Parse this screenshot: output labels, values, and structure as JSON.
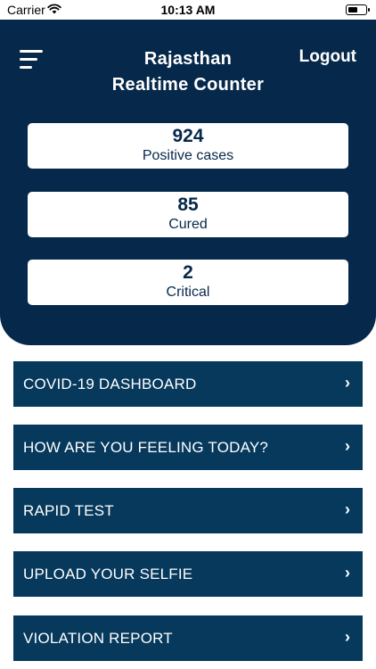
{
  "status_bar": {
    "carrier": "Carrier",
    "time": "10:13 AM",
    "battery_level": 0.55
  },
  "header": {
    "title_line1": "Rajasthan",
    "title_line2": "Realtime Counter",
    "logout_label": "Logout",
    "background_color": "#06284a"
  },
  "stats": [
    {
      "value": "924",
      "label": "Positive cases"
    },
    {
      "value": "85",
      "label": "Cured"
    },
    {
      "value": "2",
      "label": "Critical"
    }
  ],
  "menu": {
    "item_color": "#06395c",
    "chevron": "›",
    "items": [
      {
        "label": "COVID-19 DASHBOARD"
      },
      {
        "label": "HOW ARE YOU FEELING TODAY?"
      },
      {
        "label": "RAPID TEST"
      },
      {
        "label": "UPLOAD YOUR SELFIE"
      },
      {
        "label": "VIOLATION REPORT"
      }
    ]
  },
  "icons": {
    "menu": "hamburger-menu-icon",
    "wifi": "wifi-icon",
    "battery": "battery-icon",
    "chevron": "chevron-right-icon"
  }
}
